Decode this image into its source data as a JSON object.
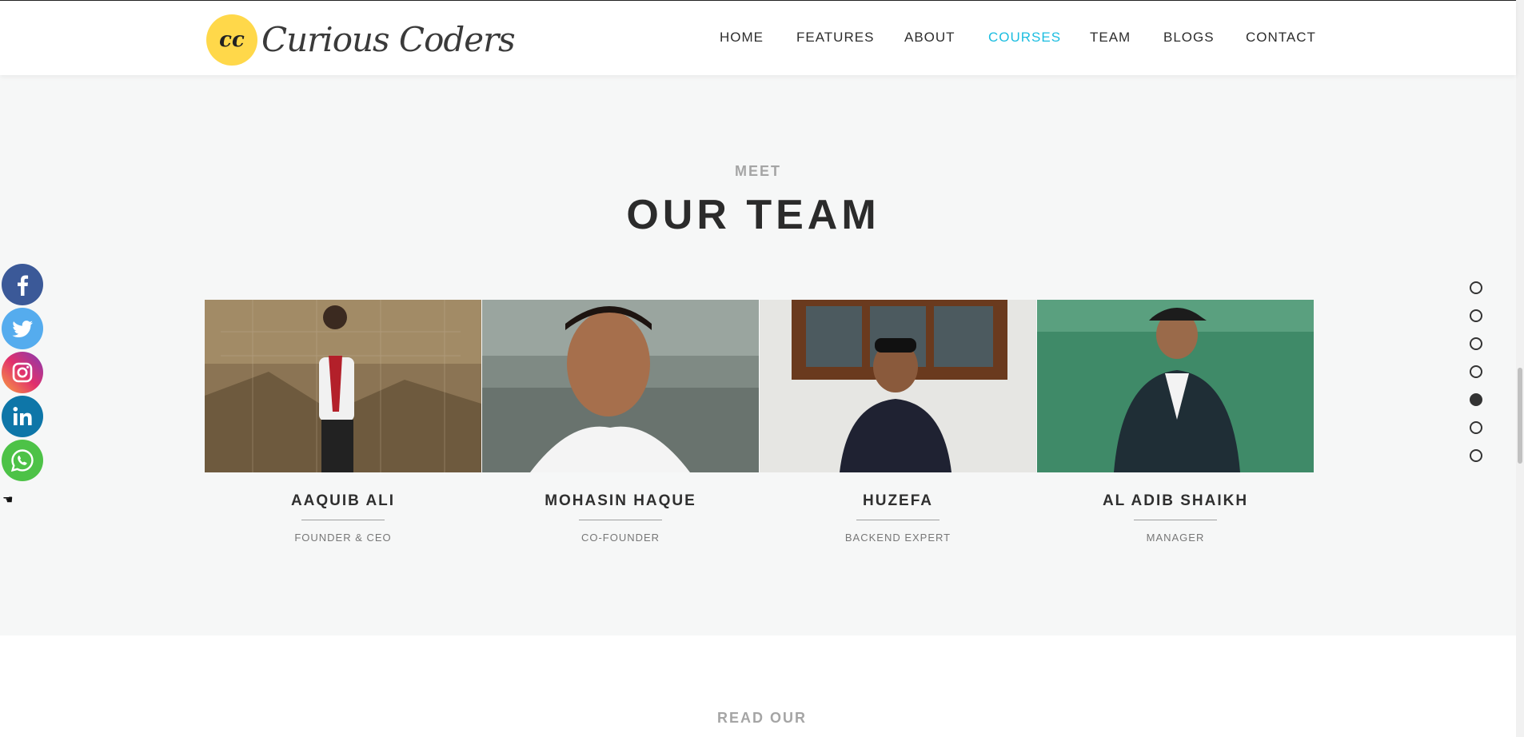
{
  "brand": {
    "logo_initials": "cc",
    "name": "Curious Coders",
    "badge_color": "#ffd84a"
  },
  "nav": {
    "items": [
      {
        "label": "HOME"
      },
      {
        "label": "FEATURES"
      },
      {
        "label": "ABOUT"
      },
      {
        "label": "COURSES",
        "active": true
      },
      {
        "label": "TEAM"
      },
      {
        "label": "BLOGS"
      },
      {
        "label": "CONTACT"
      }
    ],
    "active_color": "#1bbde0"
  },
  "team": {
    "kicker": "MEET",
    "title": "OUR TEAM",
    "members": [
      {
        "name": "AAQUIB ALI",
        "role": "FOUNDER & CEO"
      },
      {
        "name": "MOHASIN HAQUE",
        "role": "CO-FOUNDER"
      },
      {
        "name": "HUZEFA",
        "role": "BACKEND EXPERT"
      },
      {
        "name": "AL ADIB SHAIKH",
        "role": "MANAGER"
      }
    ]
  },
  "next_section": {
    "kicker": "READ OUR"
  },
  "social": [
    {
      "icon": "facebook-icon",
      "color": "#3b5998"
    },
    {
      "icon": "twitter-icon",
      "color": "#55acee"
    },
    {
      "icon": "instagram-icon",
      "color": "#e1306c"
    },
    {
      "icon": "linkedin-icon",
      "color": "#0e76a8"
    },
    {
      "icon": "whatsapp-icon",
      "color": "#4dc247"
    }
  ],
  "section_dots": {
    "count": 7,
    "active_index": 4
  }
}
